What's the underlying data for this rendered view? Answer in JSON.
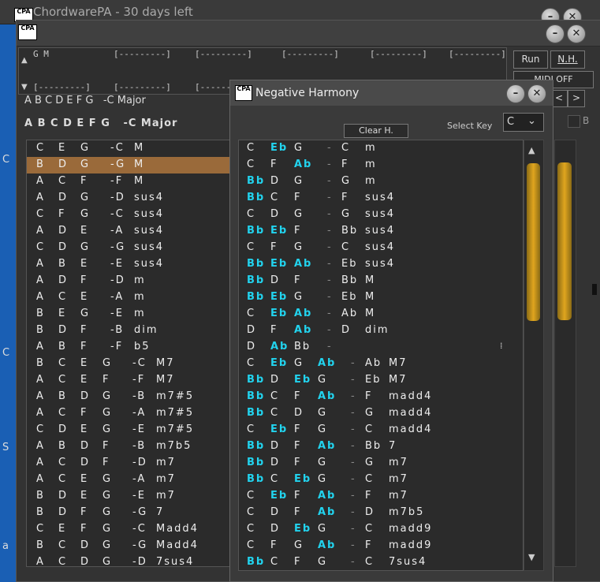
{
  "back_window": {
    "title": "ChordwarePA - 30 days left",
    "logo": "CPA"
  },
  "main_window": {
    "logo": "CPA",
    "top_grid": {
      "row1": [
        "G M",
        "[---------]",
        "[---------]",
        "[---------]",
        "[---------]",
        "[---------]"
      ],
      "row2": [
        "[---------]",
        "[---------]",
        "[---------]"
      ]
    },
    "run_label": "Run",
    "nh_label": "N.H.",
    "midi_label": "MIDI OFF",
    "scale_header_small": "A B C D E F G   -C Major",
    "scale_header": "A B C D E F G   -C Major",
    "chords": [
      {
        "notes": "C E G",
        "root": "-C",
        "q": "M"
      },
      {
        "notes": "B D G",
        "root": "-G",
        "q": "M"
      },
      {
        "notes": "A C F",
        "root": "-F",
        "q": "M"
      },
      {
        "notes": "A D G",
        "root": "-D",
        "q": "sus4"
      },
      {
        "notes": "C F G",
        "root": "-C",
        "q": "sus4"
      },
      {
        "notes": "A D E",
        "root": "-A",
        "q": "sus4"
      },
      {
        "notes": "C D G",
        "root": "-G",
        "q": "sus4"
      },
      {
        "notes": "A B E",
        "root": "-E",
        "q": "sus4"
      },
      {
        "notes": "A D F",
        "root": "-D",
        "q": "m"
      },
      {
        "notes": "A C E",
        "root": "-A",
        "q": "m"
      },
      {
        "notes": "B E G",
        "root": "-E",
        "q": "m"
      },
      {
        "notes": "B D F",
        "root": "-B",
        "q": "dim"
      },
      {
        "notes": "A B F",
        "root": "-F",
        "q": "b5"
      },
      {
        "notes": "B C E G",
        "root": "-C",
        "q": "M7"
      },
      {
        "notes": "A C E F",
        "root": "-F",
        "q": "M7"
      },
      {
        "notes": "A B D G",
        "root": "-B",
        "q": "m7#5"
      },
      {
        "notes": "A C F G",
        "root": "-A",
        "q": "m7#5"
      },
      {
        "notes": "C D E G",
        "root": "-E",
        "q": "m7#5"
      },
      {
        "notes": "A B D F",
        "root": "-B",
        "q": "m7b5"
      },
      {
        "notes": "A C D F",
        "root": "-D",
        "q": "m7"
      },
      {
        "notes": "A C E G",
        "root": "-A",
        "q": "m7"
      },
      {
        "notes": "B D E G",
        "root": "-E",
        "q": "m7"
      },
      {
        "notes": "B D F G",
        "root": "-G",
        "q": "7"
      },
      {
        "notes": "C E F G",
        "root": "-C",
        "q": "Madd4"
      },
      {
        "notes": "B C D G",
        "root": "-G",
        "q": "Madd4"
      },
      {
        "notes": "A C D G",
        "root": "-D",
        "q": "7sus4"
      }
    ],
    "selected_index": 1
  },
  "dialog": {
    "logo": "CPA",
    "title": "Negative Harmony",
    "clear_label": "Clear H.",
    "select_key_label": "Select Key",
    "key_value": "C",
    "rows": [
      {
        "n": [
          [
            "C",
            0
          ],
          [
            "Eb",
            1
          ],
          [
            "G",
            0
          ]
        ],
        "root": "C",
        "q": "m"
      },
      {
        "n": [
          [
            "C",
            0
          ],
          [
            "F",
            0
          ],
          [
            "Ab",
            1
          ]
        ],
        "root": "F",
        "q": "m"
      },
      {
        "n": [
          [
            "Bb",
            1
          ],
          [
            "D",
            0
          ],
          [
            "G",
            0
          ]
        ],
        "root": "G",
        "q": "m"
      },
      {
        "n": [
          [
            "Bb",
            1
          ],
          [
            "C",
            0
          ],
          [
            "F",
            0
          ]
        ],
        "root": "F",
        "q": "sus4"
      },
      {
        "n": [
          [
            "C",
            0
          ],
          [
            "D",
            0
          ],
          [
            "G",
            0
          ]
        ],
        "root": "G",
        "q": "sus4"
      },
      {
        "n": [
          [
            "Bb",
            1
          ],
          [
            "Eb",
            1
          ],
          [
            "F",
            0
          ]
        ],
        "root": "Bb",
        "q": "sus4"
      },
      {
        "n": [
          [
            "C",
            0
          ],
          [
            "F",
            0
          ],
          [
            "G",
            0
          ]
        ],
        "root": "C",
        "q": "sus4"
      },
      {
        "n": [
          [
            "Bb",
            1
          ],
          [
            "Eb",
            1
          ],
          [
            "Ab",
            1
          ]
        ],
        "root": "Eb",
        "q": "sus4"
      },
      {
        "n": [
          [
            "Bb",
            1
          ],
          [
            "D",
            0
          ],
          [
            "F",
            0
          ]
        ],
        "root": "Bb",
        "q": "M"
      },
      {
        "n": [
          [
            "Bb",
            1
          ],
          [
            "Eb",
            1
          ],
          [
            "G",
            0
          ]
        ],
        "root": "Eb",
        "q": "M"
      },
      {
        "n": [
          [
            "C",
            0
          ],
          [
            "Eb",
            1
          ],
          [
            "Ab",
            1
          ]
        ],
        "root": "Ab",
        "q": "M"
      },
      {
        "n": [
          [
            "D",
            0
          ],
          [
            "F",
            0
          ],
          [
            "Ab",
            1
          ]
        ],
        "root": "D",
        "q": "dim"
      },
      {
        "n": [
          [
            "D",
            0
          ],
          [
            "Ab",
            1
          ],
          [
            "Bb",
            0
          ]
        ],
        "root": "",
        "q": ""
      },
      {
        "n": [
          [
            "C",
            0
          ],
          [
            "Eb",
            1
          ],
          [
            "G",
            0
          ],
          [
            "Ab",
            1
          ]
        ],
        "root": "Ab",
        "q": "M7"
      },
      {
        "n": [
          [
            "Bb",
            1
          ],
          [
            "D",
            0
          ],
          [
            "Eb",
            1
          ],
          [
            "G",
            0
          ]
        ],
        "root": "Eb",
        "q": "M7"
      },
      {
        "n": [
          [
            "Bb",
            1
          ],
          [
            "C",
            0
          ],
          [
            "F",
            0
          ],
          [
            "Ab",
            1
          ]
        ],
        "root": "F",
        "q": "madd4"
      },
      {
        "n": [
          [
            "Bb",
            1
          ],
          [
            "C",
            0
          ],
          [
            "D",
            0
          ],
          [
            "G",
            0
          ]
        ],
        "root": "G",
        "q": "madd4"
      },
      {
        "n": [
          [
            "C",
            0
          ],
          [
            "Eb",
            1
          ],
          [
            "F",
            0
          ],
          [
            "G",
            0
          ]
        ],
        "root": "C",
        "q": "madd4"
      },
      {
        "n": [
          [
            "Bb",
            1
          ],
          [
            "D",
            0
          ],
          [
            "F",
            0
          ],
          [
            "Ab",
            1
          ]
        ],
        "root": "Bb",
        "q": "7"
      },
      {
        "n": [
          [
            "Bb",
            1
          ],
          [
            "D",
            0
          ],
          [
            "F",
            0
          ],
          [
            "G",
            0
          ]
        ],
        "root": "G",
        "q": "m7"
      },
      {
        "n": [
          [
            "Bb",
            1
          ],
          [
            "C",
            0
          ],
          [
            "Eb",
            1
          ],
          [
            "G",
            0
          ]
        ],
        "root": "C",
        "q": "m7"
      },
      {
        "n": [
          [
            "C",
            0
          ],
          [
            "Eb",
            1
          ],
          [
            "F",
            0
          ],
          [
            "Ab",
            1
          ]
        ],
        "root": "F",
        "q": "m7"
      },
      {
        "n": [
          [
            "C",
            0
          ],
          [
            "D",
            0
          ],
          [
            "F",
            0
          ],
          [
            "Ab",
            1
          ]
        ],
        "root": "D",
        "q": "m7b5"
      },
      {
        "n": [
          [
            "C",
            0
          ],
          [
            "D",
            0
          ],
          [
            "Eb",
            1
          ],
          [
            "G",
            0
          ]
        ],
        "root": "C",
        "q": "madd9"
      },
      {
        "n": [
          [
            "C",
            0
          ],
          [
            "F",
            0
          ],
          [
            "G",
            0
          ],
          [
            "Ab",
            1
          ]
        ],
        "root": "F",
        "q": "madd9"
      },
      {
        "n": [
          [
            "Bb",
            1
          ],
          [
            "C",
            0
          ],
          [
            "F",
            0
          ],
          [
            "G",
            0
          ]
        ],
        "root": "C",
        "q": "7sus4"
      }
    ]
  },
  "colors": {
    "accent_cyan": "#22d3ee",
    "selected_row": "#9a6a3a",
    "scroll_thumb": "#e0a51e"
  }
}
